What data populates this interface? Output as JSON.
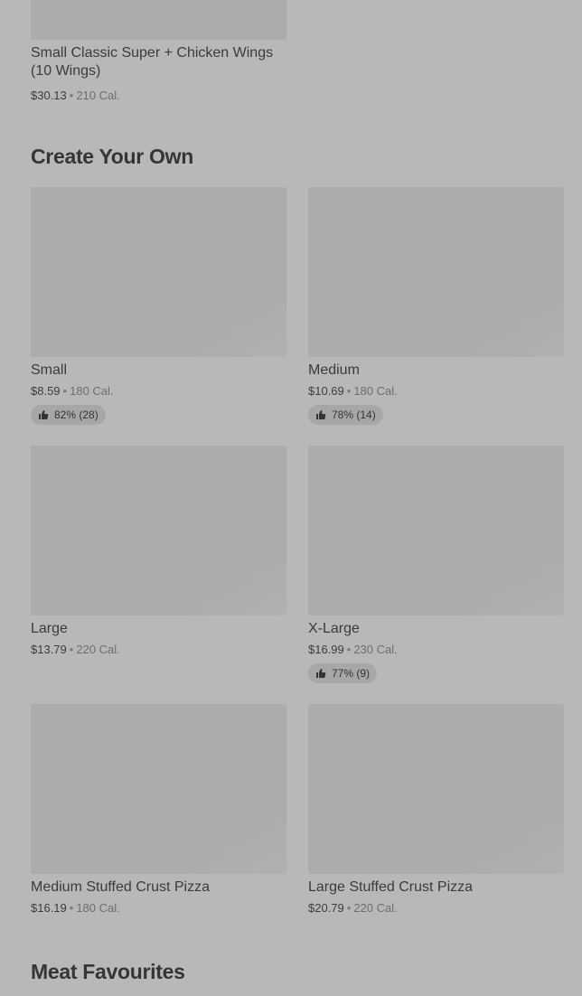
{
  "top_item": {
    "name": "Small Classic Super + Chicken Wings (10 Wings)",
    "price": "$30.13",
    "calories": "210 Cal."
  },
  "sections": [
    {
      "title": "Create Your Own",
      "items": [
        {
          "name": "Small",
          "price": "$8.59",
          "calories": "180 Cal.",
          "rating": "82% (28)"
        },
        {
          "name": "Medium",
          "price": "$10.69",
          "calories": "180 Cal.",
          "rating": "78% (14)"
        },
        {
          "name": "Large",
          "price": "$13.79",
          "calories": "220 Cal."
        },
        {
          "name": "X-Large",
          "price": "$16.99",
          "calories": "230 Cal.",
          "rating": "77% (9)"
        },
        {
          "name": "Medium Stuffed Crust Pizza",
          "price": "$16.19",
          "calories": "180 Cal."
        },
        {
          "name": "Large Stuffed Crust Pizza",
          "price": "$20.79",
          "calories": "220 Cal."
        }
      ]
    },
    {
      "title": "Meat Favourites"
    }
  ],
  "separator": "•",
  "icons": {
    "rating": "thumbs-up-icon"
  }
}
